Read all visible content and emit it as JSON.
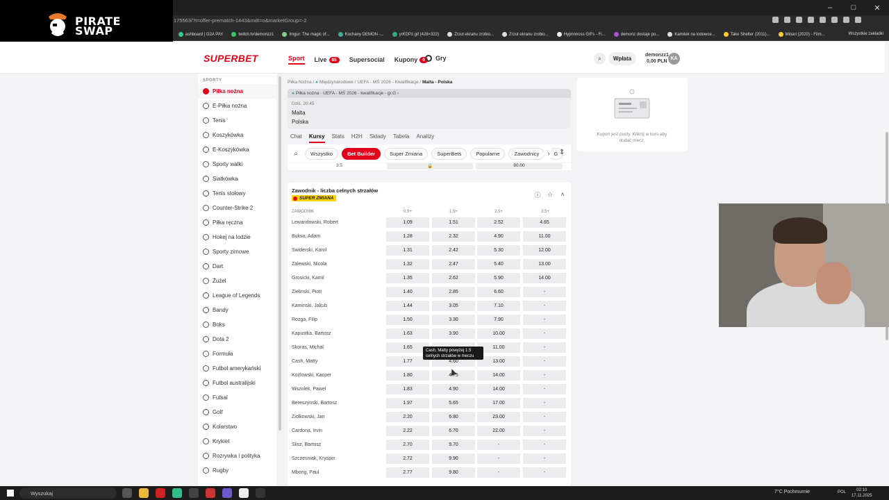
{
  "browser": {
    "url": "175563/?t=offer-prematch-1443&mdt=o&marketGroup=-2",
    "bookmarks": [
      "ashboard | G2A PAY",
      "twitch.tv/demonzz1",
      "Imgur: The magic of...",
      "Kochany DEMON -...",
      "yrKDPz.gif (428×322)",
      "Zrzut ekranu zrobio...",
      "Zrzut ekranu zrobio...",
      "Hypnnnoss GIFs - Fi...",
      "demonz dostaje po...",
      "Kamilek na lodowce...",
      "Take Shelter (2011)...",
      "Minari (2020) - Film..."
    ],
    "bookmarks_all": "Wszystkie zakładki"
  },
  "overlay": {
    "line1": "PIRATE",
    "line2": "SWAP"
  },
  "header": {
    "brand": "SUPERBET",
    "nav": [
      {
        "label": "Sport",
        "badge": ""
      },
      {
        "label": "Live",
        "badge": "85"
      },
      {
        "label": "Supersocial",
        "badge": ""
      },
      {
        "label": "Kupony",
        "badge": "0"
      }
    ],
    "games": "Gry",
    "deposit": "Wpłata",
    "username": "demonzz1",
    "balance": "0,00 PLN",
    "avatar_initials": "KA"
  },
  "sidebar": {
    "title": "SPORTY",
    "items": [
      "Piłka nożna",
      "E-Piłka nożna",
      "Tenis",
      "Koszykówka",
      "E-Koszykówka",
      "Sporty walki",
      "Siatkówka",
      "Tenis stołowy",
      "Counter-Strike 2",
      "Piłka ręczna",
      "Hokej na lodzie",
      "Sporty zimowe",
      "Dart",
      "Żużel",
      "League of Legends",
      "Bandy",
      "Boks",
      "Dota 2",
      "Formuła",
      "Futbol amerykański",
      "Futbol australijski",
      "Futsal",
      "Golf",
      "Kolarstwo",
      "Krykiet",
      "Rozrywka i polityka",
      "Rugby"
    ]
  },
  "breadcrumb": {
    "b1": "Piłka Nożna",
    "b2": "Międzynarodowe",
    "b3": "UEFA - MŚ 2026 - Kwalifikacje",
    "b4": "Malta - Polska"
  },
  "event": {
    "competition": "Piłka nożna · UEFA - MŚ 2026 - kwalifikacje - gr.G",
    "time": "Dziś, 20:45",
    "home": "Malta",
    "away": "Polska"
  },
  "tabs": [
    "Chat",
    "Kursy",
    "Stats",
    "H2H",
    "Składy",
    "Tabela",
    "Analizy"
  ],
  "filters": [
    "Wszystko",
    "Bet Builder",
    "Super Zmiana",
    "SuperBets",
    "Popularne",
    "Zawodnicy",
    "G"
  ],
  "prev_row": {
    "line": "3.5",
    "odd": "80.00"
  },
  "market": {
    "title": "Zawodnik - liczba celnych strzałów",
    "badge": "SUPER ZMIANA",
    "player_col": "ZAWODNIK",
    "columns": [
      "0.5+",
      "1.5+",
      "2.5+",
      "3.5+"
    ],
    "rows": [
      {
        "name": "Lewandowski, Robert",
        "odds": [
          "1.09",
          "1.51",
          "2.52",
          "4.65"
        ]
      },
      {
        "name": "Buksa, Adam",
        "odds": [
          "1.28",
          "2.32",
          "4.90",
          "11.00"
        ]
      },
      {
        "name": "Swiderski, Karol",
        "odds": [
          "1.31",
          "2.42",
          "5.30",
          "12.00"
        ]
      },
      {
        "name": "Zalewski, Nicola",
        "odds": [
          "1.32",
          "2.47",
          "5.40",
          "13.00"
        ]
      },
      {
        "name": "Grosicki, Kamil",
        "odds": [
          "1.35",
          "2.62",
          "5.90",
          "14.00"
        ]
      },
      {
        "name": "Zielinski, Piotr",
        "odds": [
          "1.40",
          "2.85",
          "6.60",
          "-"
        ]
      },
      {
        "name": "Kaminski, Jakub",
        "odds": [
          "1.44",
          "3.05",
          "7.10",
          "-"
        ]
      },
      {
        "name": "Rozga, Filip",
        "odds": [
          "1.50",
          "3.30",
          "7.90",
          "-"
        ]
      },
      {
        "name": "Kapustka, Bartosz",
        "odds": [
          "1.63",
          "3.90",
          "10.00",
          "-"
        ]
      },
      {
        "name": "Skoras, Michal",
        "odds": [
          "1.65",
          "",
          "11.00",
          "-"
        ]
      },
      {
        "name": "Cash, Matty",
        "odds": [
          "1.77",
          "4.60",
          "13.00",
          "-"
        ]
      },
      {
        "name": "Kozlowski, Kacper",
        "odds": [
          "1.80",
          "4.75",
          "14.00",
          "-"
        ]
      },
      {
        "name": "Wszolek, Pawel",
        "odds": [
          "1.83",
          "4.90",
          "14.00",
          "-"
        ]
      },
      {
        "name": "Bereszynski, Bartosz",
        "odds": [
          "1.97",
          "5.65",
          "17.00",
          "-"
        ]
      },
      {
        "name": "Ziolkowski, Jan",
        "odds": [
          "2.20",
          "6.80",
          "23.00",
          "-"
        ]
      },
      {
        "name": "Cardona, Irvin",
        "odds": [
          "2.22",
          "6.70",
          "22.00",
          "-"
        ]
      },
      {
        "name": "Slisz, Bartosz",
        "odds": [
          "2.70",
          "9.70",
          "-",
          "-"
        ]
      },
      {
        "name": "Szczesniak, Kryspin",
        "odds": [
          "2.72",
          "9.90",
          "-",
          "-"
        ]
      },
      {
        "name": "Mbong, Paul",
        "odds": [
          "2.77",
          "9.80",
          "-",
          "-"
        ]
      }
    ]
  },
  "tooltip": {
    "line1": "Cash, Matty powyżej 1.5",
    "line2": "celnych strzałów w meczu"
  },
  "coupon": {
    "line1": "Kupon jest pusty. Kliknij w kurs aby",
    "line2": "dodać mecz."
  },
  "taskbar": {
    "search": "Wyszukaj",
    "weather": "7°C  Pochmurnie",
    "lang": "POL",
    "time": "02:10",
    "date": "17.11.2025"
  },
  "colors": {
    "brand": "#e2001a",
    "badge": "#ffd200"
  }
}
